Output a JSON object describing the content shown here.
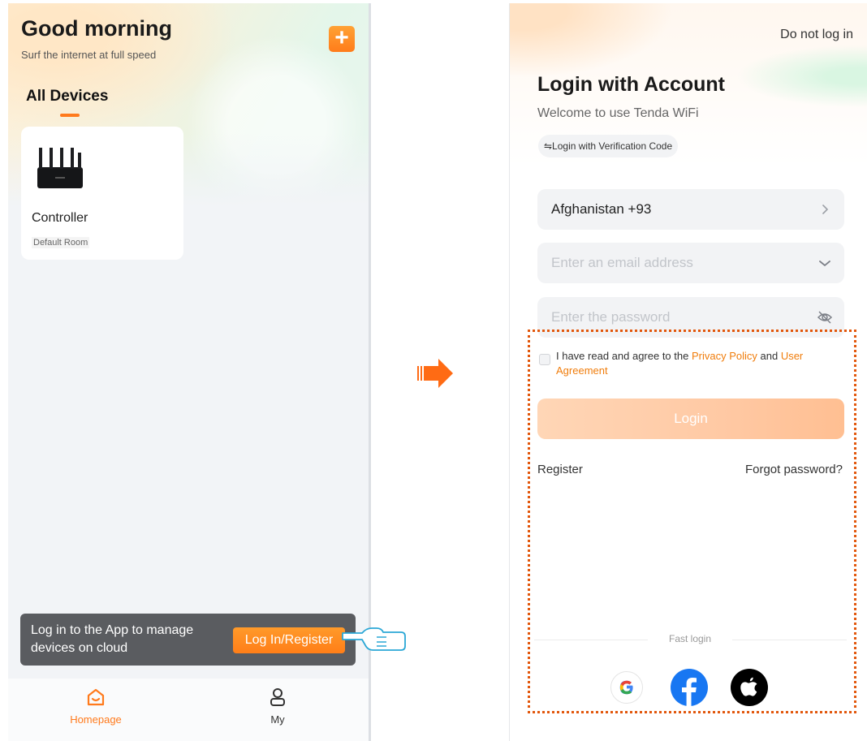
{
  "home": {
    "greeting": "Good morning",
    "subtitle": "Surf the internet at full speed",
    "add_button": "+",
    "tab_label": "All Devices",
    "device": {
      "name": "Controller",
      "room": "Default Room"
    },
    "login_banner": {
      "message": "Log in to the App to manage devices on cloud",
      "button": "Log In/Register"
    },
    "nav": [
      {
        "label": "Homepage",
        "icon": "home-icon",
        "active": true
      },
      {
        "label": "My",
        "icon": "user-icon",
        "active": false
      }
    ]
  },
  "login": {
    "skip": "Do not log in",
    "title": "Login with Account",
    "welcome": "Welcome to use Tenda WiFi",
    "switch_mode": "⇋Login with Verification Code",
    "country": "Afghanistan +93",
    "email_placeholder": "Enter an email address",
    "password_placeholder": "Enter the password",
    "agreement_prefix": "I have read and agree to the ",
    "privacy_policy": "Privacy Policy",
    "agreement_and": " and ",
    "user_agreement": "User Agreement",
    "login_button": "Login",
    "register": "Register",
    "forgot_password": "Forgot password?",
    "fast_login": "Fast login",
    "social": [
      "google-icon",
      "facebook-icon",
      "apple-icon"
    ]
  },
  "colors": {
    "accent": "#ff7a1c",
    "link": "#f07d0c",
    "highlight_frame": "#e2570c",
    "banner_bg": "#5a5c60",
    "facebook": "#1877f2"
  }
}
